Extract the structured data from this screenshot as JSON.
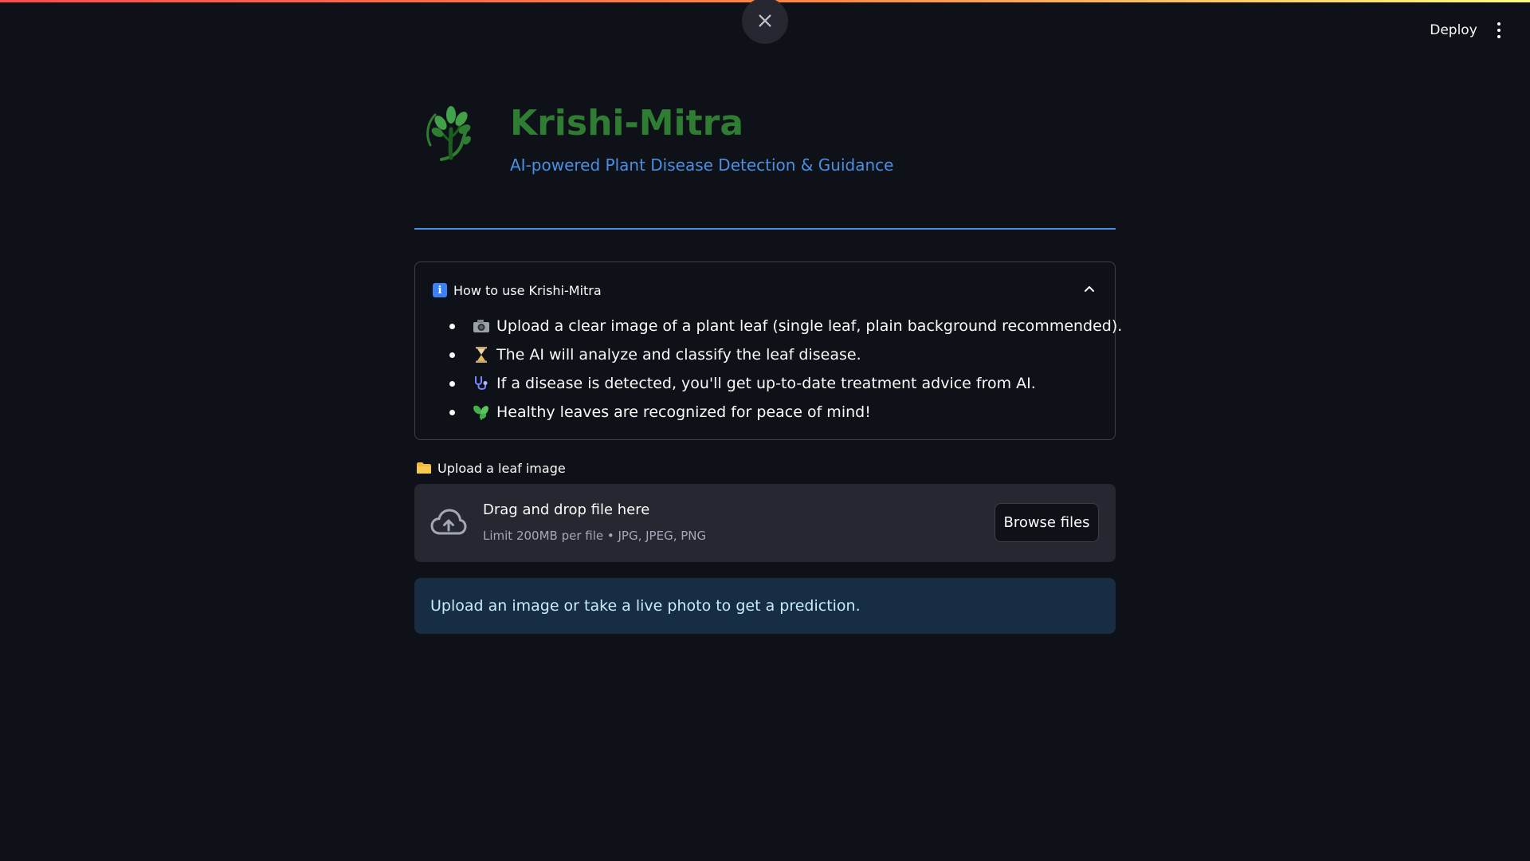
{
  "header": {
    "close_label": "Close",
    "deploy_label": "Deploy",
    "menu_icon": "more-vertical-icon"
  },
  "app": {
    "title": "Krishi-Mitra",
    "subtitle": "AI-powered Plant Disease Detection & Guidance",
    "logo_icon": "tree-logo",
    "title_color": "#2e7d32",
    "subtitle_color": "#4a90e2"
  },
  "expander": {
    "title": "How to use Krishi-Mitra",
    "icon": "info-icon",
    "expanded": true,
    "items": [
      {
        "icon": "camera-icon",
        "text": "Upload a clear image of a plant leaf (single leaf, plain background recommended)."
      },
      {
        "icon": "hourglass-icon",
        "text": "The AI will analyze and classify the leaf disease."
      },
      {
        "icon": "stethoscope-icon",
        "text": "If a disease is detected, you'll get up-to-date treatment advice from AI."
      },
      {
        "icon": "herb-icon",
        "text": "Healthy leaves are recognized for peace of mind!"
      }
    ]
  },
  "uploader": {
    "label": "Upload a leaf image",
    "label_icon": "folder-icon",
    "drop_title": "Drag and drop file here",
    "drop_limit": "Limit 200MB per file • JPG, JPEG, PNG",
    "browse_label": "Browse files"
  },
  "info_message": "Upload an image or take a live photo to get a prediction.",
  "colors": {
    "background": "#0e1117",
    "accent_blue": "#4a90e2",
    "info_bg": "#172d43",
    "info_text": "#c7ebff",
    "dropzone_bg": "#262730"
  }
}
